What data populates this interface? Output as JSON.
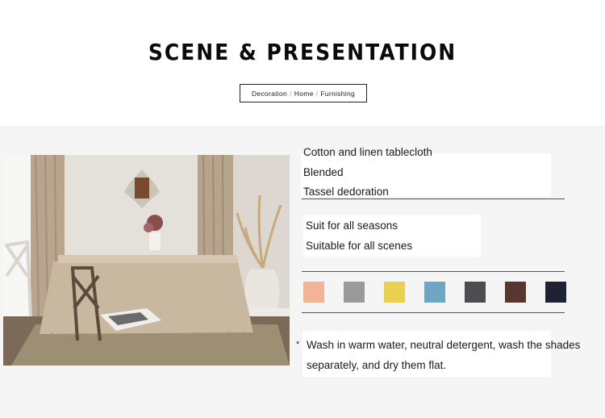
{
  "heading": {
    "title": "SCENE & PRESENTATION",
    "breadcrumb": [
      "Decoration",
      "Home",
      "Furnishing"
    ]
  },
  "features_group_1": [
    "Cotton and linen tablecloth",
    "Blended",
    "Tassel dedoration"
  ],
  "features_group_2": [
    "Suit for all seasons",
    "Suitable for all scenes"
  ],
  "color_swatches": [
    "#f4b396",
    "#9a9a9c",
    "#e9d14f",
    "#6fa6c4",
    "#4d4d4f",
    "#5b3530",
    "#1f2233"
  ],
  "care": {
    "bullet": "*",
    "line1": "Wash in warm water, neutral detergent, wash the shades",
    "line2": "separately, and dry them flat."
  }
}
